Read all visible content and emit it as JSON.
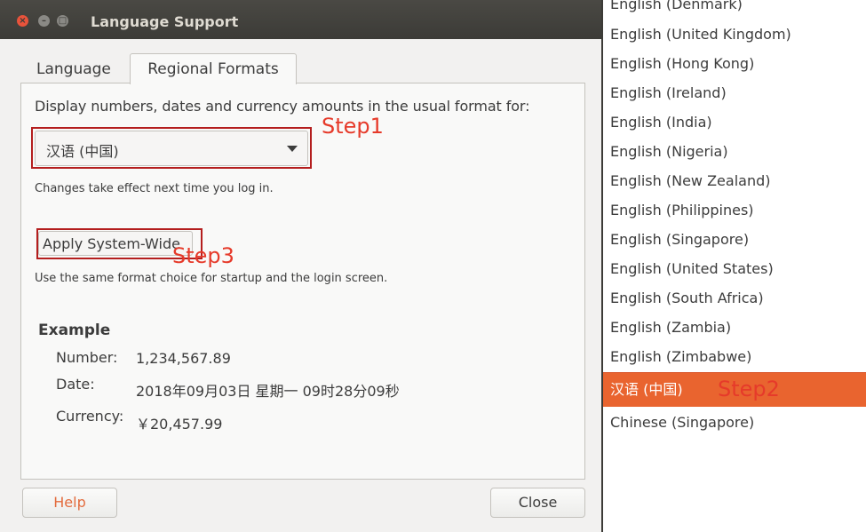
{
  "window": {
    "title": "Language Support",
    "close_glyph": "×",
    "min_glyph": "–",
    "max_glyph": "□"
  },
  "tabs": [
    {
      "label": "Language",
      "selected": false
    },
    {
      "label": "Regional Formats",
      "selected": true
    }
  ],
  "regional": {
    "description": "Display numbers, dates and currency amounts in the usual format for:",
    "dropdown_value": "汉语 (中国)",
    "changes_note": "Changes take effect next time you log in.",
    "apply_button": "Apply System-Wide",
    "apply_note": "Use the same format choice for startup and the login screen."
  },
  "example": {
    "heading": "Example",
    "number_label": "Number:",
    "number_value": "1,234,567.89",
    "date_label": "Date:",
    "date_value": "2018年09月03日 星期一 09时28分09秒",
    "currency_label": "Currency:",
    "currency_value": "￥20,457.99"
  },
  "buttons": {
    "help": "Help",
    "close": "Close"
  },
  "annotations": {
    "step1": "Step1",
    "step2": "Step2",
    "step3": "Step3",
    "color": "#e63a2a"
  },
  "locale_list": {
    "items": [
      "English (Denmark)",
      "English (United Kingdom)",
      "English (Hong Kong)",
      "English (Ireland)",
      "English (India)",
      "English (Nigeria)",
      "English (New Zealand)",
      "English (Philippines)",
      "English (Singapore)",
      "English (United States)",
      "English (South Africa)",
      "English (Zambia)",
      "English (Zimbabwe)",
      "汉语 (中国)",
      "Chinese (Singapore)"
    ],
    "selected_index": 13,
    "selected_color": "#e9642f"
  }
}
